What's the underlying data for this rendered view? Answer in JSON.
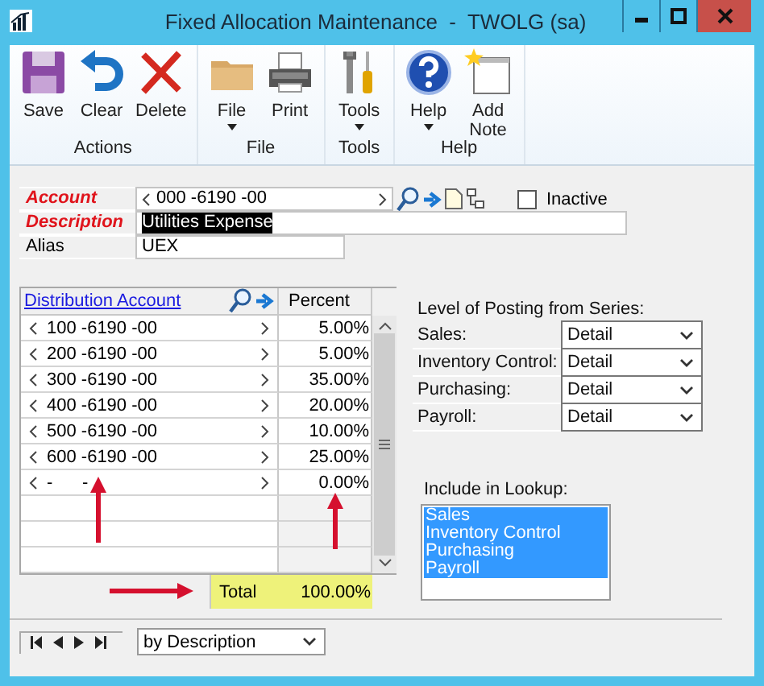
{
  "window": {
    "title": "Fixed Allocation Maintenance  -  TWOLG (sa)"
  },
  "ribbon": {
    "groups": [
      {
        "label": "Actions",
        "buttons": [
          {
            "label": "Save",
            "dropdown": false
          },
          {
            "label": "Clear",
            "dropdown": false
          },
          {
            "label": "Delete",
            "dropdown": false
          }
        ]
      },
      {
        "label": "File",
        "buttons": [
          {
            "label": "File",
            "dropdown": true
          },
          {
            "label": "Print",
            "dropdown": false
          }
        ]
      },
      {
        "label": "Tools",
        "buttons": [
          {
            "label": "Tools",
            "dropdown": true
          }
        ]
      },
      {
        "label": "Help",
        "buttons": [
          {
            "label": "Help",
            "dropdown": true
          },
          {
            "label": "Add Note",
            "dropdown": false
          }
        ]
      }
    ]
  },
  "form": {
    "fields": [
      {
        "kind": "lookup",
        "label": "Account",
        "required": true,
        "value": "000 -6190 -00"
      },
      {
        "kind": "text",
        "label": "Description",
        "required": true,
        "value": "Utilities Expense",
        "selected": true
      },
      {
        "kind": "text",
        "label": "Alias",
        "required": false,
        "value": "UEX",
        "selected": false
      }
    ],
    "inactive": {
      "label": "Inactive",
      "checked": false
    }
  },
  "grid": {
    "columns": [
      "Distribution Account",
      "Percent"
    ],
    "rows": [
      {
        "account": "100 -6190 -00",
        "percent": "5.00%"
      },
      {
        "account": "200 -6190 -00",
        "percent": "5.00%"
      },
      {
        "account": "300 -6190 -00",
        "percent": "35.00%"
      },
      {
        "account": "400 -6190 -00",
        "percent": "20.00%"
      },
      {
        "account": "500 -6190 -00",
        "percent": "10.00%"
      },
      {
        "account": "600 -6190 -00",
        "percent": "25.00%"
      },
      {
        "account": "-      -",
        "percent": "0.00%"
      }
    ],
    "total": {
      "label": "Total",
      "value": "100.00%",
      "highlighted": true
    }
  },
  "annotations": [
    {
      "kind": "arrow"
    },
    {
      "kind": "arrow"
    },
    {
      "kind": "arrow"
    }
  ],
  "posting": {
    "title": "Level of Posting from Series:",
    "rows": [
      {
        "label": "Sales:",
        "value": "Detail"
      },
      {
        "label": "Inventory Control:",
        "value": "Detail"
      },
      {
        "label": "Purchasing:",
        "value": "Detail"
      },
      {
        "label": "Payroll:",
        "value": "Detail"
      }
    ]
  },
  "lookup": {
    "title": "Include in Lookup:",
    "items": [
      {
        "label": "Sales",
        "selected": true
      },
      {
        "label": "Inventory Control",
        "selected": true
      },
      {
        "label": "Purchasing",
        "selected": true
      },
      {
        "label": "Payroll",
        "selected": true
      }
    ]
  },
  "navigation": {
    "sort": "by Description"
  }
}
